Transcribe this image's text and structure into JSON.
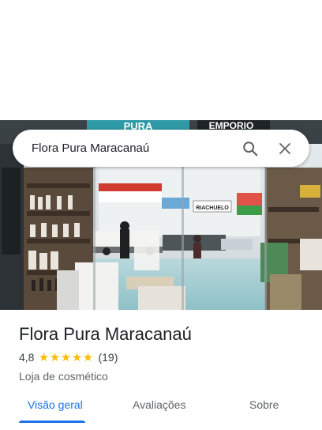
{
  "search": {
    "query": "Flora Pura Maracanaú",
    "search_icon": "search-icon",
    "close_icon": "close-icon"
  },
  "photo": {
    "signs": [
      "PURA",
      "EMPORIO",
      "RIACHUELO"
    ]
  },
  "place": {
    "name": "Flora Pura Maracanaú",
    "rating": "4,8",
    "stars": 4.8,
    "review_count": "(19)",
    "category": "Loja de cosmético"
  },
  "tabs": [
    {
      "label": "Visão geral",
      "active": true
    },
    {
      "label": "Avaliações",
      "active": false
    },
    {
      "label": "Sobre",
      "active": false
    }
  ],
  "colors": {
    "accent": "#1a73e8",
    "star": "#fbbc04",
    "text_primary": "#202124",
    "text_secondary": "#5f6368"
  }
}
